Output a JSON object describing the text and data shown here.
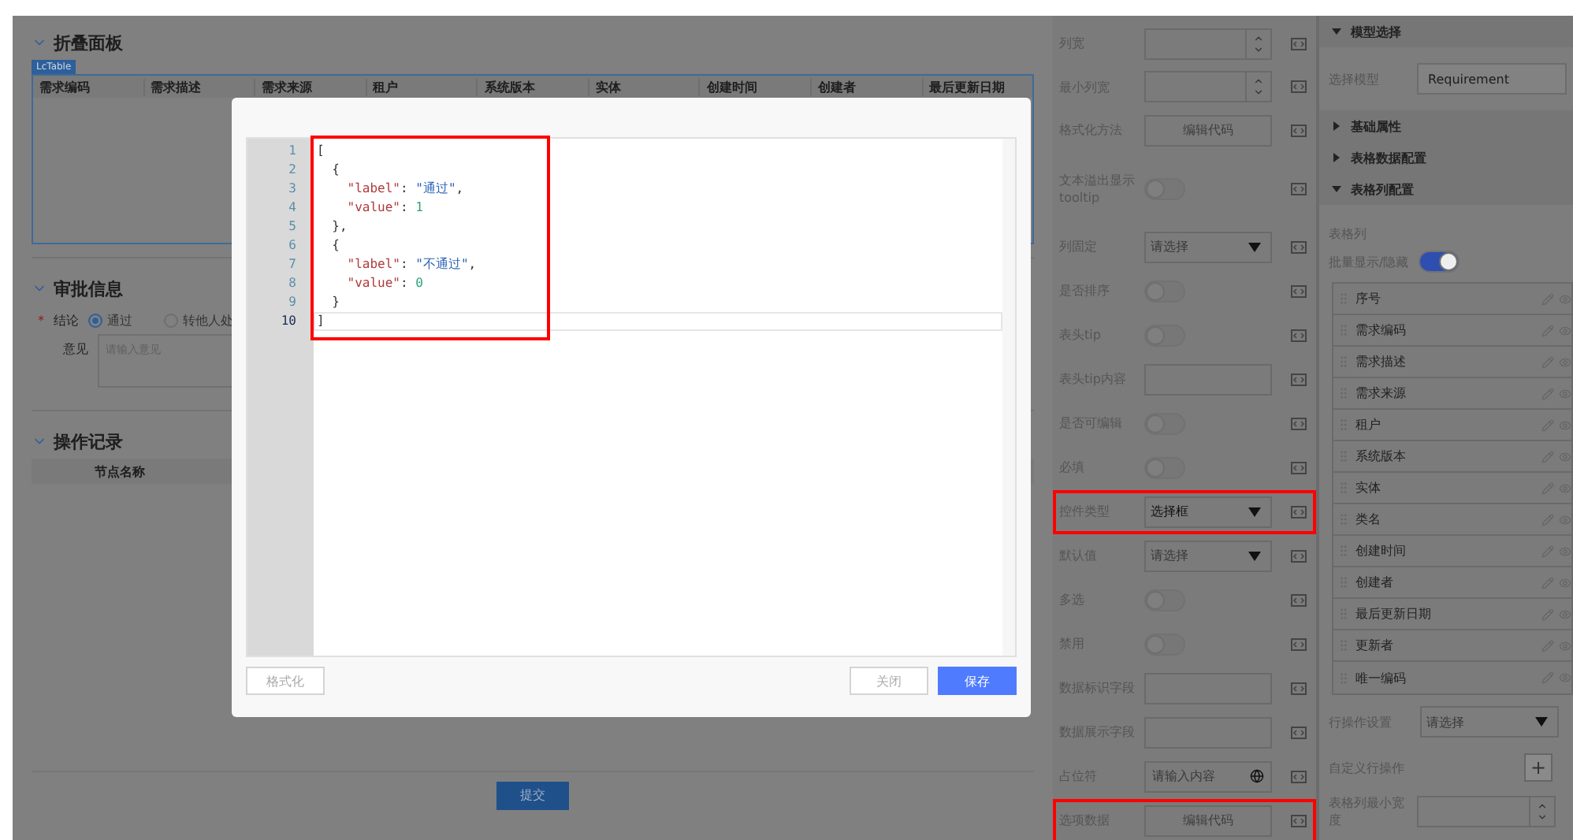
{
  "panel_section": {
    "title": "折叠面板",
    "expanded": true,
    "tag": "LcTable",
    "columns": [
      "需求编码",
      "需求描述",
      "需求来源",
      "租户",
      "系统版本",
      "实体",
      "创建时间",
      "创建者",
      "最后更新日期"
    ]
  },
  "approval": {
    "title": "审批信息",
    "expanded": true,
    "required_mark": "*",
    "conclusion_label": "结论",
    "options": [
      {
        "label": "通过",
        "selected": true
      },
      {
        "label": "转他人处",
        "selected": false
      }
    ],
    "opinion_label": "意见",
    "opinion_placeholder": "请输入意见"
  },
  "records": {
    "title": "操作记录",
    "expanded": true,
    "columns": [
      "节点名称"
    ]
  },
  "submit_button": "提交",
  "modal": {
    "highlighted": true,
    "lines": [
      {
        "number": "1",
        "active": false,
        "tokens": [
          {
            "kind": "punct",
            "text": "["
          }
        ]
      },
      {
        "number": "2",
        "active": false,
        "tokens": [
          {
            "kind": "punct",
            "text": "  {"
          }
        ]
      },
      {
        "number": "3",
        "active": false,
        "tokens": [
          {
            "kind": "key",
            "text": "    \"label\""
          },
          {
            "kind": "punct",
            "text": ": "
          },
          {
            "kind": "string",
            "text": "\"通过\""
          },
          {
            "kind": "punct",
            "text": ","
          }
        ]
      },
      {
        "number": "4",
        "active": false,
        "tokens": [
          {
            "kind": "key",
            "text": "    \"value\""
          },
          {
            "kind": "punct",
            "text": ": "
          },
          {
            "kind": "number",
            "text": "1"
          }
        ]
      },
      {
        "number": "5",
        "active": false,
        "tokens": [
          {
            "kind": "punct",
            "text": "  },"
          }
        ]
      },
      {
        "number": "6",
        "active": false,
        "tokens": [
          {
            "kind": "punct",
            "text": "  {"
          }
        ]
      },
      {
        "number": "7",
        "active": false,
        "tokens": [
          {
            "kind": "key",
            "text": "    \"label\""
          },
          {
            "kind": "punct",
            "text": ": "
          },
          {
            "kind": "string",
            "text": "\"不通过\""
          },
          {
            "kind": "punct",
            "text": ","
          }
        ]
      },
      {
        "number": "8",
        "active": false,
        "tokens": [
          {
            "kind": "key",
            "text": "    \"value\""
          },
          {
            "kind": "punct",
            "text": ": "
          },
          {
            "kind": "number",
            "text": "0"
          }
        ]
      },
      {
        "number": "9",
        "active": false,
        "tokens": [
          {
            "kind": "punct",
            "text": "  }"
          }
        ]
      },
      {
        "number": "10",
        "active": true,
        "tokens": [
          {
            "kind": "punct",
            "text": "]"
          }
        ]
      }
    ],
    "format_button": "格式化",
    "close_button": "关闭",
    "save_button": "保存"
  },
  "property_rows": [
    {
      "label": "列宽",
      "kind": "number",
      "highlighted": false
    },
    {
      "label": "最小列宽",
      "kind": "number",
      "highlighted": false
    },
    {
      "label": "格式化方法",
      "kind": "code",
      "button": "编辑代码",
      "highlighted": false
    },
    {
      "label": "文本溢出显示tooltip",
      "kind": "toggle",
      "on": false,
      "highlighted": false
    },
    {
      "label": "列固定",
      "kind": "select",
      "placeholder": "请选择",
      "highlighted": false
    },
    {
      "label": "是否排序",
      "kind": "toggle",
      "on": false,
      "highlighted": false
    },
    {
      "label": "表头tip",
      "kind": "toggle",
      "on": false,
      "highlighted": false
    },
    {
      "label": "表头tip内容",
      "kind": "input",
      "highlighted": false
    },
    {
      "label": "是否可编辑",
      "kind": "toggle",
      "on": false,
      "highlighted": false
    },
    {
      "label": "必填",
      "kind": "toggle",
      "on": false,
      "highlighted": false
    },
    {
      "label": "控件类型",
      "kind": "select",
      "value": "选择框",
      "highlighted": true
    },
    {
      "label": "默认值",
      "kind": "select",
      "placeholder": "请选择",
      "highlighted": false
    },
    {
      "label": "多选",
      "kind": "toggle",
      "on": false,
      "highlighted": false
    },
    {
      "label": "禁用",
      "kind": "toggle",
      "on": false,
      "highlighted": false
    },
    {
      "label": "数据标识字段",
      "kind": "input",
      "highlighted": false
    },
    {
      "label": "数据展示字段",
      "kind": "input",
      "highlighted": false
    },
    {
      "label": "占位符",
      "kind": "lang-input",
      "placeholder": "请输入内容",
      "highlighted": false
    },
    {
      "label": "选项数据",
      "kind": "code",
      "button": "编辑代码",
      "highlighted": true
    }
  ],
  "config_panel": {
    "model_header": {
      "title": "模型选择",
      "expanded": true
    },
    "model_label": "选择模型",
    "model_value": "Requirement",
    "headers": [
      {
        "title": "基础属性",
        "expanded": false
      },
      {
        "title": "表格数据配置",
        "expanded": false
      },
      {
        "title": "表格列配置",
        "expanded": true
      }
    ],
    "columns_label": "表格列",
    "batch_label": "批量显示/隐藏",
    "batch_on": true,
    "columns": [
      "序号",
      "需求编码",
      "需求描述",
      "需求来源",
      "租户",
      "系统版本",
      "实体",
      "类名",
      "创建时间",
      "创建者",
      "最后更新日期",
      "更新者",
      "唯一编码"
    ],
    "row_action_label": "行操作设置",
    "row_action_placeholder": "请选择",
    "custom_action_label": "自定义行操作",
    "custom_action_button": "+",
    "min_width_label": "表格列最小宽度"
  }
}
